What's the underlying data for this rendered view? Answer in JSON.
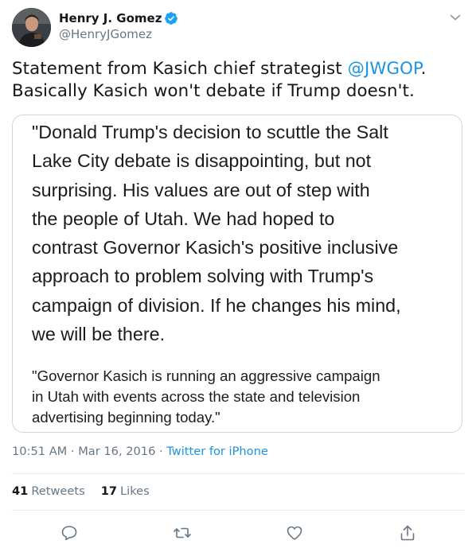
{
  "author": {
    "display_name": "Henry J. Gomez",
    "handle": "@HenryJGomez",
    "verified": true,
    "avatar": "profile-photo"
  },
  "tweet": {
    "text_before": "Statement from Kasich chief strategist ",
    "mention": "@JWGOP",
    "text_after_mention": ".",
    "text_line2": "Basically Kasich won't debate if Trump doesn't."
  },
  "media": {
    "quote_lines": [
      "\"Donald Trump's decision to scuttle the Salt",
      "Lake City debate is disappointing, but not",
      "surprising. His values are out of step with",
      "the people of Utah. We had hoped to",
      "contrast Governor Kasich's positive inclusive",
      "approach to problem solving with Trump's",
      "campaign of division. If he changes his mind,",
      "we will be there."
    ],
    "second_lines": [
      "\"Governor Kasich is running an aggressive campaign",
      "in Utah with events across the state and television",
      "advertising beginning today.\""
    ]
  },
  "meta": {
    "time": "10:51 AM",
    "date": "Mar 16, 2016",
    "separator": "·",
    "source": "Twitter for iPhone"
  },
  "stats": {
    "retweets_count": "41",
    "retweets_label": "Retweets",
    "likes_count": "17",
    "likes_label": "Likes"
  },
  "colors": {
    "link": "#1b95e0",
    "muted": "#657786",
    "text": "#14171a",
    "verified": "#1da1f2"
  },
  "icons": [
    "chevron-down-icon",
    "verified-badge-icon",
    "reply-icon",
    "retweet-icon",
    "like-icon",
    "share-icon"
  ]
}
